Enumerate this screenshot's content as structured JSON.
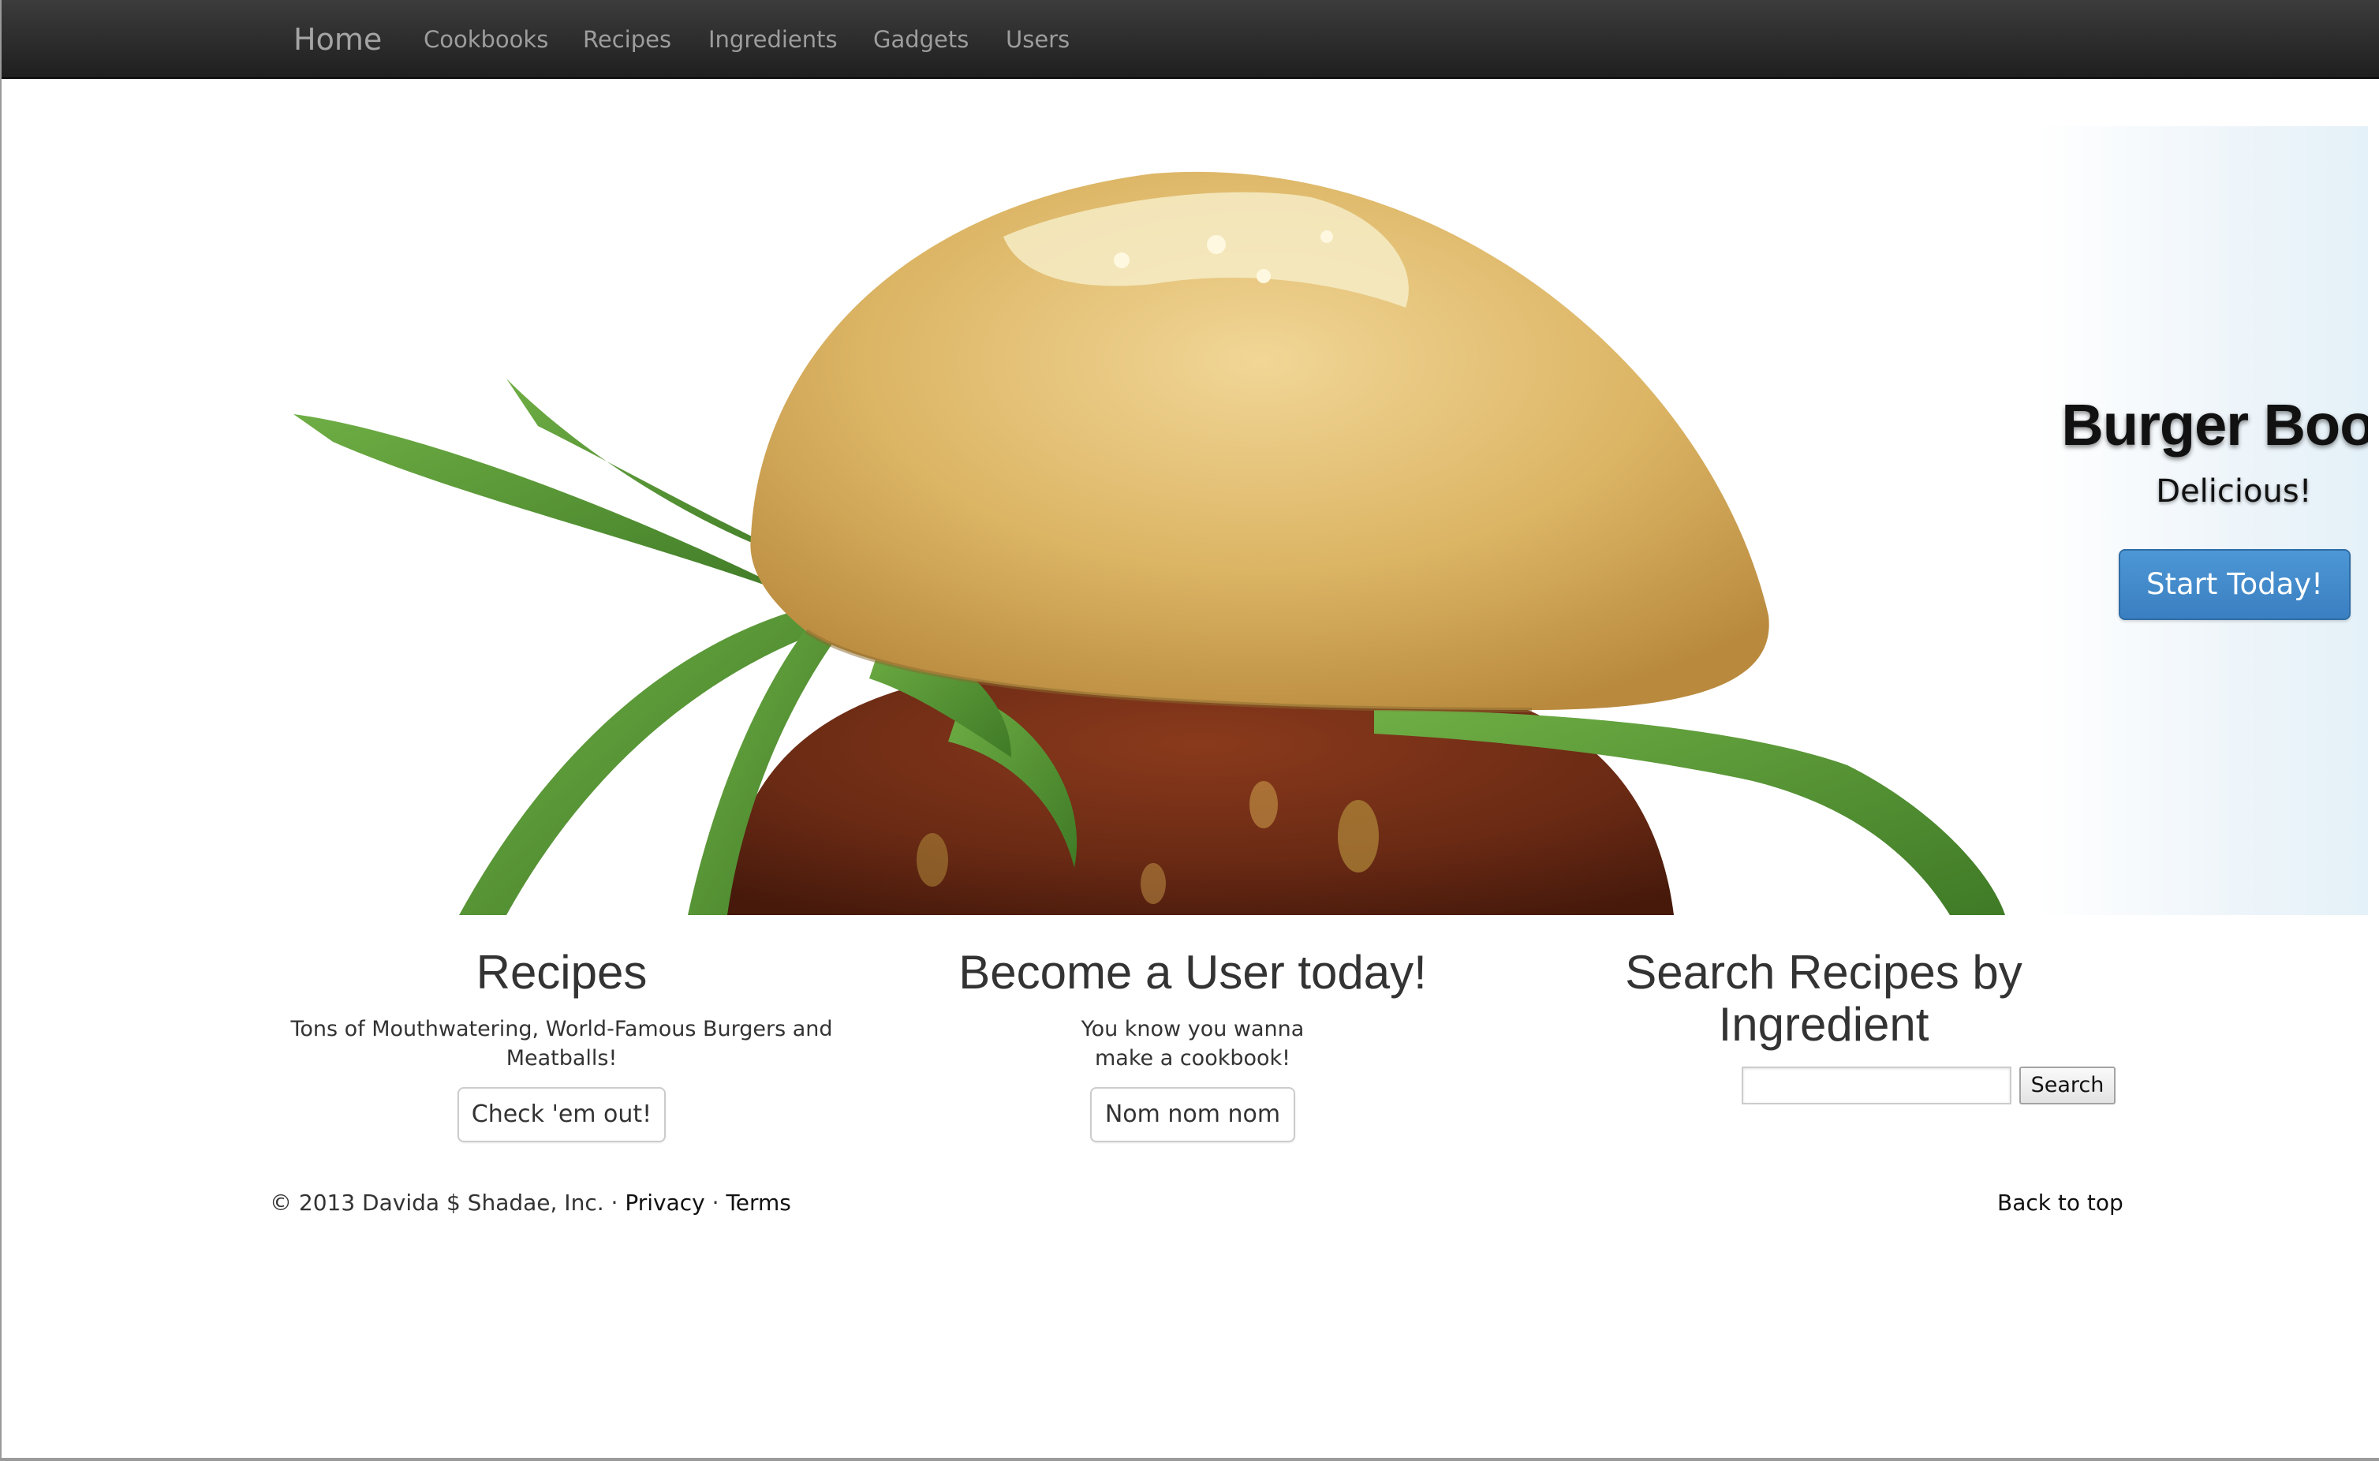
{
  "nav": {
    "brand": "Home",
    "items": [
      {
        "label": "Cookbooks"
      },
      {
        "label": "Recipes"
      },
      {
        "label": "Ingredients"
      },
      {
        "label": "Gadgets"
      },
      {
        "label": "Users"
      }
    ]
  },
  "hero": {
    "title": "Burger Book",
    "subtitle": "Delicious!",
    "button_label": "Start Today!",
    "accent_color": "#428bca"
  },
  "columns": [
    {
      "title": "Recipes",
      "text": "Tons of Mouthwatering, World-Famous Burgers and Meatballs!",
      "button_label": "Check 'em out!"
    },
    {
      "title": "Become a User today!",
      "text": "You know you wanna make a cookbook!",
      "button_label": "Nom nom nom"
    },
    {
      "title": "Search Recipes by Ingredient",
      "search_value": "",
      "search_button_label": "Search"
    }
  ],
  "footer": {
    "copyright": "© 2013 Davida $ Shadae, Inc. ·",
    "privacy": "Privacy",
    "separator": "·",
    "terms": "Terms",
    "back_to_top": "Back to top"
  }
}
